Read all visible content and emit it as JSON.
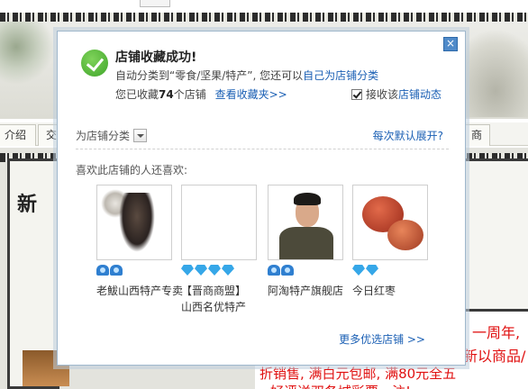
{
  "background": {
    "nav_tabs": [
      "介绍",
      "交",
      "商"
    ],
    "side_char": "新",
    "promo_lines": [
      "一周年,",
      "新以商品/",
      "折销售, 满白元包邮, 满80元全五",
      "好评送双各城彩票一注!"
    ]
  },
  "popup": {
    "close_icon": "close-icon",
    "title": "店铺收藏成功!",
    "line1_prefix": "自动分类到“零食/坚果/特产”, 您还可以",
    "line1_link": "自己为店铺分类",
    "line2_prefix": "您已收藏",
    "favorite_count": "74",
    "line2_suffix": "个店铺",
    "view_favorites_link": "查看收藏夹>>",
    "receive_checkbox": {
      "checked": true,
      "label_prefix": "接收该",
      "label_link": "店铺动态"
    },
    "category_label": "为店铺分类",
    "expand_link": "每次默认展开?",
    "also_like_label": "喜欢此店铺的人还喜欢:",
    "shops": [
      {
        "rating_icons": [
          "crown",
          "crown"
        ],
        "name": "老鮁山西特产专卖"
      },
      {
        "rating_icons": [
          "diamond",
          "diamond",
          "diamond",
          "diamond"
        ],
        "name": "【晋商商盟】山西名优特产"
      },
      {
        "rating_icons": [
          "crown",
          "crown"
        ],
        "name": "阿淘特产旗舰店"
      },
      {
        "rating_icons": [
          "diamond",
          "diamond"
        ],
        "name": "今日红枣"
      }
    ],
    "more_link": "更多优选店铺 >>"
  },
  "colors": {
    "link": "#1a5fb4",
    "success": "#3fa52a",
    "promo_red": "#e01010"
  }
}
